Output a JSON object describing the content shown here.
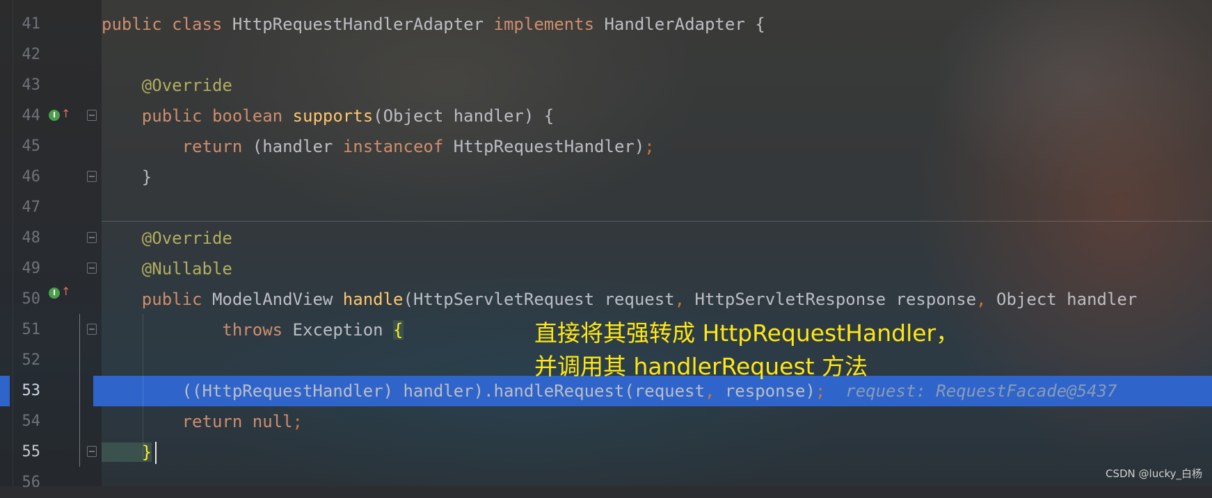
{
  "editor": {
    "lines": [
      {
        "number": "41",
        "tokens": [
          {
            "t": "public class ",
            "c": "kw"
          },
          {
            "t": "HttpRequestHandlerAdapter ",
            "c": "pl"
          },
          {
            "t": "implements ",
            "c": "kw"
          },
          {
            "t": "HandlerAdapter {",
            "c": "pl"
          }
        ]
      },
      {
        "number": "42",
        "tokens": []
      },
      {
        "number": "43",
        "tokens": [
          {
            "t": "    @Override",
            "c": "an"
          }
        ]
      },
      {
        "number": "44",
        "tokens": [
          {
            "t": "    public ",
            "c": "kw"
          },
          {
            "t": "boolean ",
            "c": "kw"
          },
          {
            "t": "supports",
            "c": "fnb"
          },
          {
            "t": "(Object handler) {",
            "c": "pl"
          }
        ]
      },
      {
        "number": "45",
        "tokens": [
          {
            "t": "        return ",
            "c": "kw"
          },
          {
            "t": "(handler ",
            "c": "pl"
          },
          {
            "t": "instanceof ",
            "c": "kw"
          },
          {
            "t": "HttpRequestHandler)",
            "c": "pl"
          },
          {
            "t": ";",
            "c": "punct"
          }
        ]
      },
      {
        "number": "46",
        "tokens": [
          {
            "t": "    }",
            "c": "pl"
          }
        ]
      },
      {
        "number": "47",
        "tokens": []
      },
      {
        "number": "48",
        "tokens": [
          {
            "t": "    @Override",
            "c": "an"
          }
        ]
      },
      {
        "number": "49",
        "tokens": [
          {
            "t": "    @Nullable",
            "c": "an"
          }
        ]
      },
      {
        "number": "50",
        "tokens": [
          {
            "t": "    public ",
            "c": "kw"
          },
          {
            "t": "ModelAndView ",
            "c": "pl"
          },
          {
            "t": "handle",
            "c": "fnb"
          },
          {
            "t": "(HttpServletRequest request",
            "c": "pl"
          },
          {
            "t": ", ",
            "c": "punct"
          },
          {
            "t": "HttpServletResponse response",
            "c": "pl"
          },
          {
            "t": ", ",
            "c": "punct"
          },
          {
            "t": "Object handler",
            "c": "pl"
          }
        ]
      },
      {
        "number": "51",
        "tokens": [
          {
            "t": "            throws ",
            "c": "kw"
          },
          {
            "t": "Exception ",
            "c": "pl"
          },
          {
            "t": "{",
            "c": "brace-hi"
          }
        ]
      },
      {
        "number": "52",
        "tokens": []
      },
      {
        "number": "53",
        "tokens": [
          {
            "t": "        ((HttpRequestHandler) handler).handleRequest(request",
            "c": "pl"
          },
          {
            "t": ", ",
            "c": "punct"
          },
          {
            "t": "response)",
            "c": "pl"
          },
          {
            "t": ";",
            "c": "punct"
          },
          {
            "t": "  request: RequestFacade@5437",
            "c": "inlay"
          }
        ]
      },
      {
        "number": "54",
        "tokens": [
          {
            "t": "        return null",
            "c": "kw"
          },
          {
            "t": ";",
            "c": "punct"
          }
        ]
      },
      {
        "number": "55",
        "tokens": [
          {
            "t": "    }",
            "c": "brace-hi"
          }
        ]
      },
      {
        "number": "56",
        "tokens": []
      }
    ],
    "highlighted_line": "53",
    "current_line": "55"
  },
  "annotation": {
    "line1": "直接将其强转成 HttpRequestHandler，",
    "line2": "并调用其 handlerRequest 方法",
    "color": "#ffe714"
  },
  "watermark": "CSDN @lucky_白杨",
  "colors": {
    "keyword": "#cf8e6d",
    "annotation": "#b3ae60",
    "method": "#ffc66d",
    "selection": "#2f65ca"
  }
}
